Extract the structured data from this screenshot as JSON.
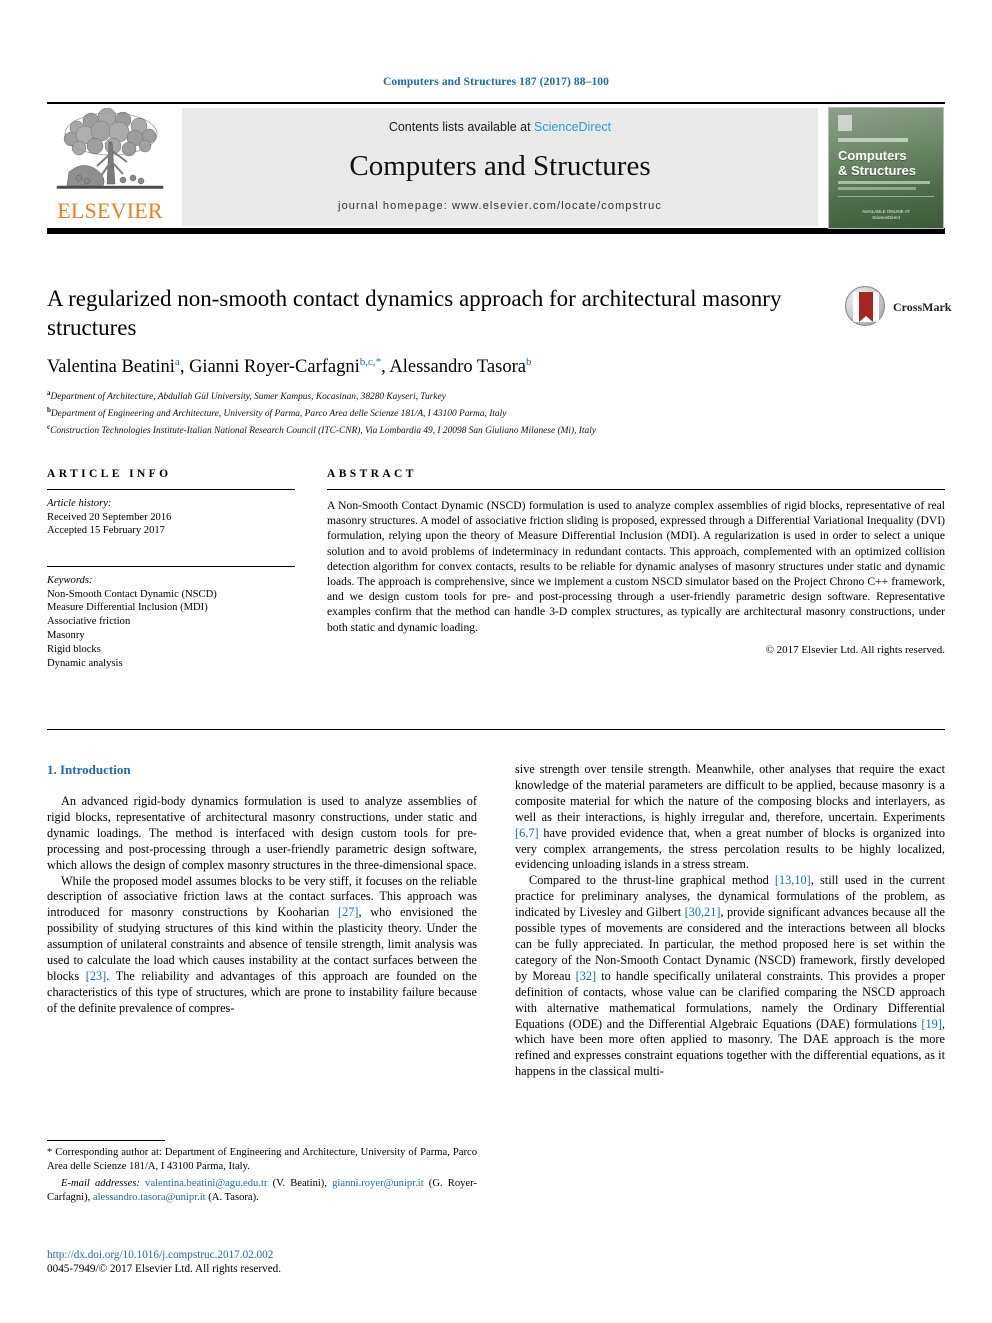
{
  "running_head": "Computers and Structures 187 (2017) 88–100",
  "masthead": {
    "contents_prefix": "Contents lists available at ",
    "sciencedirect": "ScienceDirect",
    "journal_title": "Computers and Structures",
    "homepage": "journal homepage: www.elsevier.com/locate/compstruc",
    "publisher": "ELSEVIER",
    "cover": {
      "name_line1": "Computers",
      "name_line2": "& Structures",
      "foot_line1": "AVAILABLE ONLINE AT",
      "foot_line2": "ScienceDirect"
    }
  },
  "article": {
    "title": "A regularized non-smooth contact dynamics approach for architectural masonry structures",
    "crossmark_label": "CrossMark",
    "authors": [
      {
        "name": "Valentina Beatini",
        "sup": "a",
        "sep": ", "
      },
      {
        "name": "Gianni Royer-Carfagni",
        "sup": "b,c,*",
        "sep": ", "
      },
      {
        "name": "Alessandro Tasora",
        "sup": "b",
        "sep": ""
      }
    ],
    "affiliations": [
      {
        "mark": "a",
        "text": "Department of Architecture, Abdullah Gül University, Sumer Kampus, Kocasinan, 38280 Kayseri, Turkey"
      },
      {
        "mark": "b",
        "text": "Department of Engineering and Architecture, University of Parma, Parco Area delle Scienze 181/A, I 43100 Parma, Italy"
      },
      {
        "mark": "c",
        "text": "Construction Technologies Institute-Italian National Research Council (ITC-CNR), Via Lombardia 49, I 20098 San Giuliano Milanese (Mi), Italy"
      }
    ]
  },
  "article_info": {
    "heading": "ARTICLE INFO",
    "history_label": "Article history:",
    "received": "Received 20 September 2016",
    "accepted": "Accepted 15 February 2017",
    "keywords_label": "Keywords:",
    "keywords": [
      "Non-Smooth Contact Dynamic (NSCD)",
      "Measure Differential Inclusion (MDI)",
      "Associative friction",
      "Masonry",
      "Rigid blocks",
      "Dynamic analysis"
    ]
  },
  "abstract": {
    "heading": "ABSTRACT",
    "text": "A Non-Smooth Contact Dynamic (NSCD) formulation is used to analyze complex assemblies of rigid blocks, representative of real masonry structures. A model of associative friction sliding is proposed, expressed through a Differential Variational Inequality (DVI) formulation, relying upon the theory of Measure Differential Inclusion (MDI). A regularization is used in order to select a unique solution and to avoid problems of indeterminacy in redundant contacts. This approach, complemented with an optimized collision detection algorithm for convex contacts, results to be reliable for dynamic analyses of masonry structures under static and dynamic loads. The approach is comprehensive, since we implement a custom NSCD simulator based on the Project Chrono C++ framework, and we design custom tools for pre- and post-processing through a user-friendly parametric design software. Representative examples confirm that the method can handle 3-D complex structures, as typically are architectural masonry constructions, under both static and dynamic loading.",
    "copyright": "© 2017 Elsevier Ltd. All rights reserved."
  },
  "introduction": {
    "heading": "1. Introduction",
    "left_paragraphs": [
      "An advanced rigid-body dynamics formulation is used to analyze assemblies of rigid blocks, representative of architectural masonry constructions, under static and dynamic loadings. The method is interfaced with design custom tools for pre-processing and post-processing through a user-friendly parametric design software, which allows the design of complex masonry structures in the three-dimensional space.",
      "While the proposed model assumes blocks to be very stiff, it focuses on the reliable description of associative friction laws at the contact surfaces. This approach was introduced for masonry constructions by Kooharian [27], who envisioned the possibility of studying structures of this kind within the plasticity theory. Under the assumption of unilateral constraints and absence of tensile strength, limit analysis was used to calculate the load which causes instability at the contact surfaces between the blocks [23]. The reliability and advantages of this approach are founded on the characteristics of this type of structures, which are prone to instability failure because of the definite prevalence of compres-"
    ],
    "right_paragraphs": [
      "sive strength over tensile strength. Meanwhile, other analyses that require the exact knowledge of the material parameters are difficult to be applied, because masonry is a composite material for which the nature of the composing blocks and interlayers, as well as their interactions, is highly irregular and, therefore, uncertain. Experiments [6,7] have provided evidence that, when a great number of blocks is organized into very complex arrangements, the stress percolation results to be highly localized, evidencing unloading islands in a stress stream.",
      "Compared to the thrust-line graphical method [13,10], still used in the current practice for preliminary analyses, the dynamical formulations of the problem, as indicated by Livesley and Gilbert [30,21], provide significant advances because all the possible types of movements are considered and the interactions between all blocks can be fully appreciated. In particular, the method proposed here is set within the category of the Non-Smooth Contact Dynamic (NSCD) framework, firstly developed by Moreau [32] to handle specifically unilateral constraints. This provides a proper definition of contacts, whose value can be clarified comparing the NSCD approach with alternative mathematical formulations, namely the Ordinary Differential Equations (ODE) and the Differential Algebraic Equations (DAE) formulations [19], which have been more often applied to masonry. The DAE approach is the more refined and expresses constraint equations together with the differential equations, as it happens in the classical multi-"
    ]
  },
  "footnote": {
    "corresponding": "* Corresponding author at: Department of Engineering and Architecture, University of Parma, Parco Area delle Scienze 181/A, I 43100 Parma, Italy.",
    "emails_label": "E-mail addresses:",
    "emails": [
      {
        "address": "valentina.beatini@agu.edu.tr",
        "who": " (V. Beatini), "
      },
      {
        "address": "gianni.royer@unipr.it",
        "who": " (G. Royer-Carfagni), "
      },
      {
        "address": "alessandro.tasora@unipr.it",
        "who": " (A. Tasora)."
      }
    ]
  },
  "doi": {
    "url": "http://dx.doi.org/10.1016/j.compstruc.2017.02.002",
    "issn_line": "0045-7949/© 2017 Elsevier Ltd. All rights reserved."
  },
  "colors": {
    "link": "#1a6ca8",
    "sciencedirect": "#2a9ed4",
    "elsevier_orange": "#ef7d20",
    "band": "#e9e9e9"
  }
}
